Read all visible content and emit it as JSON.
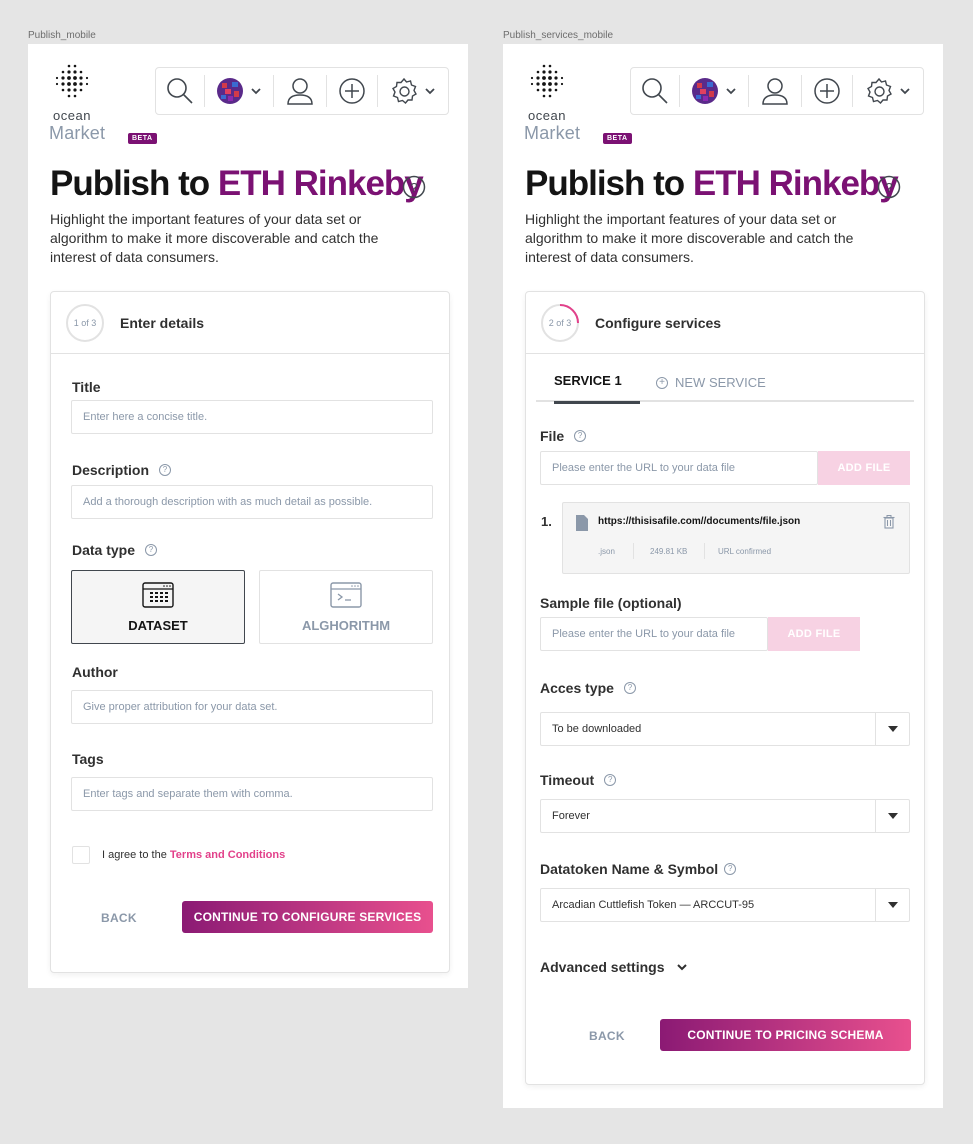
{
  "frames": [
    {
      "label": "Publish_mobile"
    },
    {
      "label": "Publish_services_mobile"
    }
  ],
  "header": {
    "logo_top": "ocean",
    "logo_bottom": "Market",
    "beta_badge": "BETA",
    "toolbar_icons": [
      "search-icon",
      "network-avatar-icon",
      "user-icon",
      "add-circle-icon",
      "gear-icon"
    ]
  },
  "page": {
    "title_prefix": "Publish to",
    "title_network": "ETH Rinkeby",
    "intro": "Highlight the important features of your data set or algorithm to make it more discoverable and catch the interest of data consumers."
  },
  "step1": {
    "step_badge": "1 of 3",
    "step_title": "Enter details",
    "title_label": "Title",
    "title_placeholder": "Enter here a concise title.",
    "description_label": "Description",
    "description_placeholder": "Add a thorough description with as much detail as possible.",
    "datatype_label": "Data type",
    "datatype_options": [
      "DATASET",
      "ALGHORITHM"
    ],
    "datatype_selected": "DATASET",
    "author_label": "Author",
    "author_placeholder": "Give proper attribution for your data set.",
    "tags_label": "Tags",
    "tags_placeholder": "Enter tags and separate them with comma.",
    "agree_text": "I agree to the",
    "terms_link": "Terms and Conditions",
    "back_label": "BACK",
    "continue_label": "CONTINUE TO CONFIGURE SERVICES",
    "progress": 0.33
  },
  "step2": {
    "step_badge": "2 of 3",
    "step_title": "Configure services",
    "tab_active": "SERVICE 1",
    "tab_new": "NEW SERVICE",
    "file_label": "File",
    "file_placeholder": "Please enter the URL to your data file",
    "add_file_label": "ADD FILE",
    "file_index": "1.",
    "file_url": "https://thisisafile.com//documents/file.json",
    "file_ext": ".json",
    "file_size": "249.81 KB",
    "file_status": "URL confirmed",
    "sample_label": "Sample file (optional)",
    "sample_placeholder": "Please enter the URL to your data file",
    "sample_add_label": "ADD FILE",
    "access_label": "Acces type",
    "access_value": "To be downloaded",
    "timeout_label": "Timeout",
    "timeout_value": "Forever",
    "datatoken_label": "Datatoken Name & Symbol",
    "datatoken_value": "Arcadian Cuttlefish Token — ARCCUT-95",
    "advanced_label": "Advanced settings",
    "back_label": "BACK",
    "continue_label": "CONTINUE TO PRICING SCHEMA",
    "progress": 0.66
  },
  "colors": {
    "brand_purple": "#7b1173",
    "brand_pink": "#e2408a",
    "gradient_start": "#8b1a74",
    "gradient_end": "#e8508e"
  }
}
